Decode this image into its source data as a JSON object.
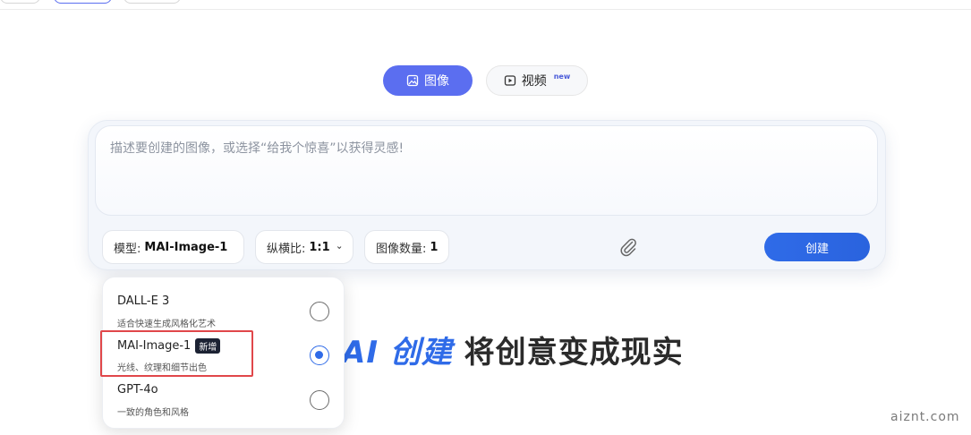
{
  "mode_tabs": [
    {
      "label": "图像",
      "icon": "image-icon",
      "active": true
    },
    {
      "label": "视频",
      "icon": "video-play-icon",
      "active": false,
      "tag": "new"
    }
  ],
  "prompt": {
    "value": "",
    "placeholder": "描述要创建的图像，或选择“给我个惊喜”以获得灵感!"
  },
  "controls": {
    "model_label": "模型:",
    "model_value": "MAI-Image-1",
    "ratio_label": "纵横比:",
    "ratio_value": "1:1",
    "count_label": "图像数量:",
    "count_value": "1",
    "attach_icon": "paperclip-icon",
    "create_label": "创建"
  },
  "headline": {
    "accent": "AI 创建",
    "rest": " 将创意变成现实"
  },
  "model_dropdown": {
    "options": [
      {
        "name": "DALL-E 3",
        "desc": "适合快速生成风格化艺术",
        "selected": false,
        "badge": ""
      },
      {
        "name": "MAI-Image-1",
        "desc": "光线、纹理和细节出色",
        "selected": true,
        "badge": "新增"
      },
      {
        "name": "GPT-4o",
        "desc": "一致的角色和风格",
        "selected": false,
        "badge": ""
      }
    ]
  },
  "watermark": "aiznt.com",
  "colors": {
    "accent": "#2f6be8",
    "mode_active": "#5b6ef0",
    "highlight": "#e0474a"
  }
}
